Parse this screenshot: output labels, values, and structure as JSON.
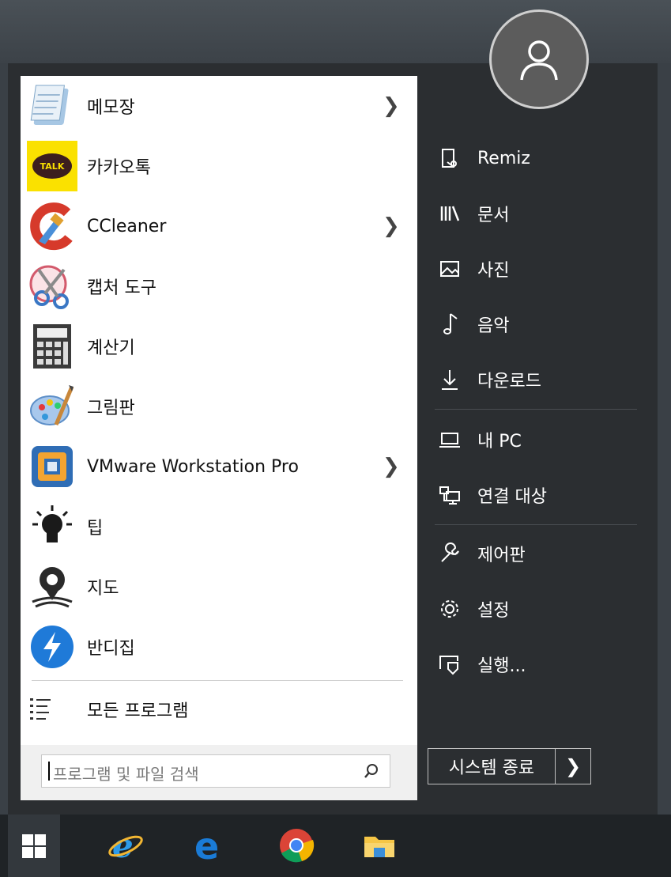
{
  "programs": [
    {
      "label": "메모장",
      "has_submenu": true,
      "icon": "notepad-icon"
    },
    {
      "label": "카카오톡",
      "has_submenu": false,
      "icon": "kakaotalk-icon"
    },
    {
      "label": "CCleaner",
      "has_submenu": true,
      "icon": "ccleaner-icon"
    },
    {
      "label": "캡처 도구",
      "has_submenu": false,
      "icon": "snipping-tool-icon"
    },
    {
      "label": "계산기",
      "has_submenu": false,
      "icon": "calculator-icon"
    },
    {
      "label": "그림판",
      "has_submenu": false,
      "icon": "paint-icon"
    },
    {
      "label": "VMware Workstation Pro",
      "has_submenu": true,
      "icon": "vmware-icon"
    },
    {
      "label": "팁",
      "has_submenu": false,
      "icon": "lightbulb-icon"
    },
    {
      "label": "지도",
      "has_submenu": false,
      "icon": "maps-icon"
    },
    {
      "label": "반디집",
      "has_submenu": false,
      "icon": "bandizip-icon"
    }
  ],
  "kakao_badge": "TALK",
  "all_programs_label": "모든 프로그램",
  "search": {
    "placeholder": "프로그램 및 파일 검색"
  },
  "right": {
    "items": [
      {
        "label": "Remiz",
        "icon": "user-folder-icon"
      },
      {
        "label": "문서",
        "icon": "library-icon"
      },
      {
        "label": "사진",
        "icon": "picture-icon"
      },
      {
        "label": "음악",
        "icon": "music-note-icon"
      },
      {
        "label": "다운로드",
        "icon": "download-icon"
      },
      {
        "label": "내 PC",
        "icon": "laptop-icon"
      },
      {
        "label": "연결 대상",
        "icon": "network-icon"
      },
      {
        "label": "제어판",
        "icon": "wrench-icon"
      },
      {
        "label": "설정",
        "icon": "gear-icon"
      },
      {
        "label": "실행...",
        "icon": "run-icon"
      }
    ]
  },
  "shutdown": {
    "label": "시스템 종료",
    "arrow": "❯"
  },
  "chevron": "❯",
  "taskbar": {
    "icons": [
      "windows-start-icon",
      "internet-explorer-icon",
      "edge-icon",
      "chrome-icon",
      "file-explorer-icon"
    ]
  },
  "colors": {
    "menu_bg": "#2b2e31",
    "list_bg": "#ffffff",
    "taskbar_bg": "#1f2326"
  }
}
